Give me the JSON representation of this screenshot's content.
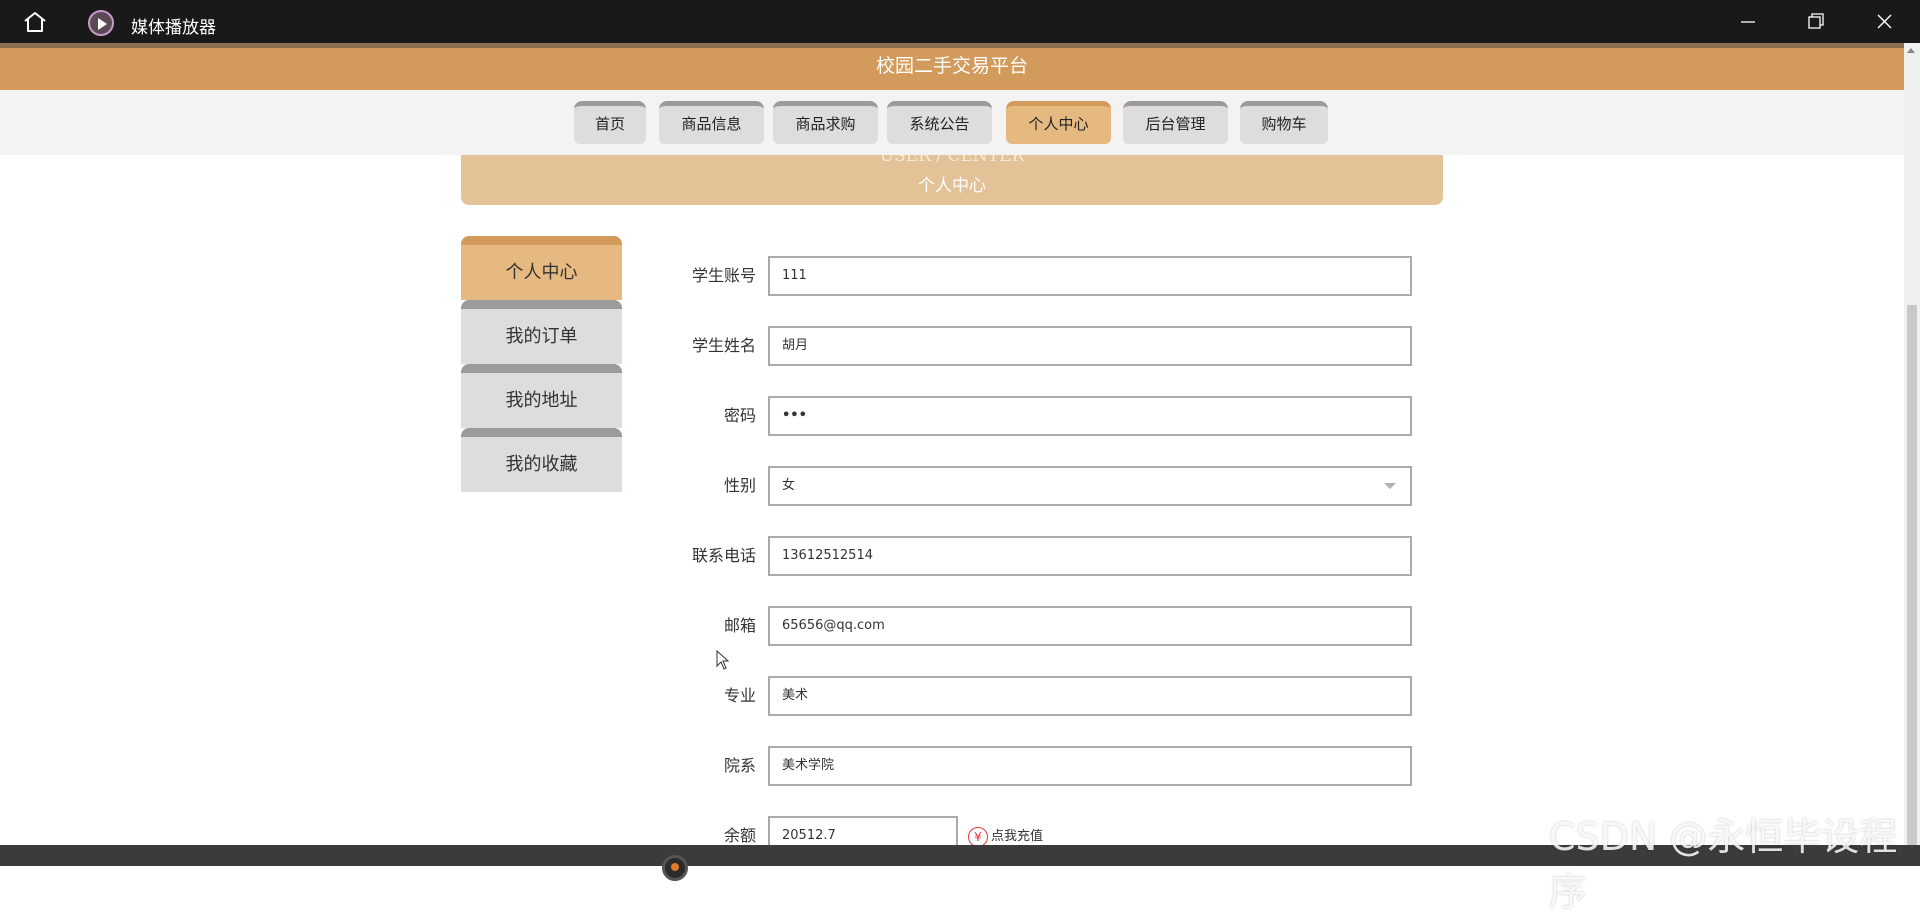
{
  "window": {
    "title": "媒体播放器"
  },
  "site": {
    "header_title": "校园二手交易平台"
  },
  "nav": {
    "items": [
      {
        "label": "首页"
      },
      {
        "label": "商品信息"
      },
      {
        "label": "商品求购"
      },
      {
        "label": "系统公告"
      },
      {
        "label": "个人中心",
        "active": true
      },
      {
        "label": "后台管理"
      },
      {
        "label": "购物车"
      }
    ]
  },
  "banner": {
    "en": "USER / CENTER",
    "cn": "个人中心"
  },
  "sidemenu": {
    "items": [
      {
        "label": "个人中心",
        "active": true
      },
      {
        "label": "我的订单"
      },
      {
        "label": "我的地址"
      },
      {
        "label": "我的收藏"
      }
    ]
  },
  "form": {
    "fields": [
      {
        "label": "学生账号",
        "value": "111"
      },
      {
        "label": "学生姓名",
        "value": "胡月"
      },
      {
        "label": "密码",
        "value": "•••"
      },
      {
        "label": "性别",
        "value": "女"
      },
      {
        "label": "联系电话",
        "value": "13612512514"
      },
      {
        "label": "邮箱",
        "value": "65656@qq.com"
      },
      {
        "label": "专业",
        "value": "美术"
      },
      {
        "label": "院系",
        "value": "美术学院"
      },
      {
        "label": "余额",
        "value": "20512.7"
      }
    ],
    "recharge_label": "点我充值",
    "recharge_icon": "¥"
  },
  "watermark": "CSDN @永恒毕设程序",
  "colors": {
    "accent": "#d29a5b",
    "accent_light": "#e6b980",
    "tab_bg": "#dedcdc"
  }
}
